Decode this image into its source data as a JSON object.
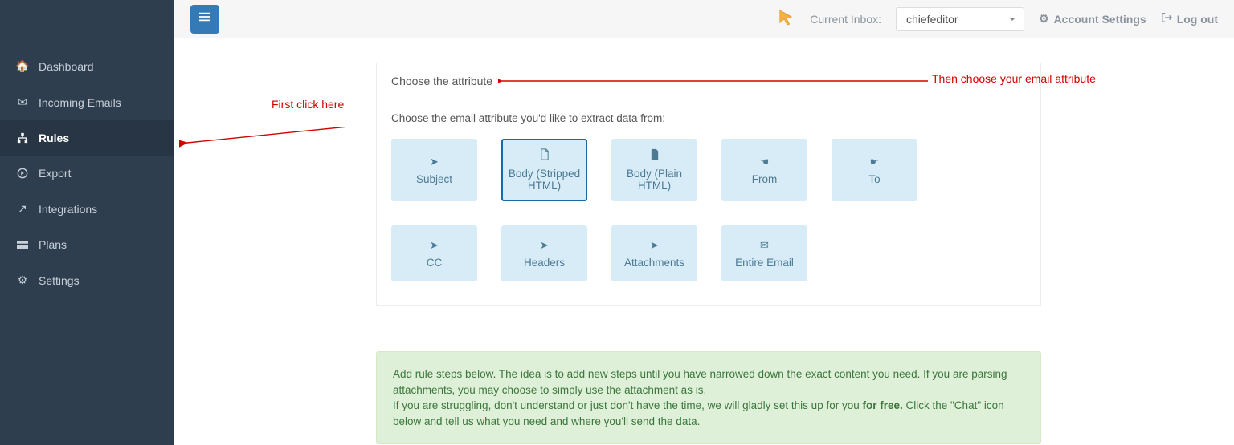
{
  "sidebar": {
    "items": [
      {
        "icon": "home",
        "label": "Dashboard"
      },
      {
        "icon": "mail",
        "label": "Incoming Emails"
      },
      {
        "icon": "sitemap",
        "label": "Rules"
      },
      {
        "icon": "circle-arrow",
        "label": "Export"
      },
      {
        "icon": "share",
        "label": "Integrations"
      },
      {
        "icon": "bars",
        "label": "Plans"
      },
      {
        "icon": "gear",
        "label": "Settings"
      }
    ],
    "active_index": 2
  },
  "topbar": {
    "current_inbox_label": "Current Inbox:",
    "inbox_value": "chiefeditor",
    "account_settings": "Account Settings",
    "logout": "Log out"
  },
  "panel": {
    "header": "Choose the attribute",
    "subtext": "Choose the email attribute you'd like to extract data from:",
    "tiles": [
      {
        "icon": "pointer",
        "label": "Subject"
      },
      {
        "icon": "file",
        "label": "Body (Stripped HTML)"
      },
      {
        "icon": "file",
        "label": "Body (Plain HTML)"
      },
      {
        "icon": "hand-left",
        "label": "From"
      },
      {
        "icon": "hand-right",
        "label": "To"
      },
      {
        "icon": "pointer",
        "label": "CC"
      },
      {
        "icon": "pointer",
        "label": "Headers"
      },
      {
        "icon": "pointer",
        "label": "Attachments"
      },
      {
        "icon": "envelope",
        "label": "Entire Email"
      }
    ],
    "selected_index": 1
  },
  "info": {
    "line1": "Add rule steps below. The idea is to add new steps until you have narrowed down the exact content you need. If you are parsing attachments, you may choose to simply use the attachment as is.",
    "line2_pre": "If you are struggling, don't understand or just don't have the time, we will gladly set this up for you ",
    "line2_bold": "for free.",
    "line2_post": " Click the \"Chat\" icon below and tell us what you need and where you'll send the data."
  },
  "annotations": {
    "first_click": "First click here",
    "then_choose": "Then choose your email attribute"
  }
}
